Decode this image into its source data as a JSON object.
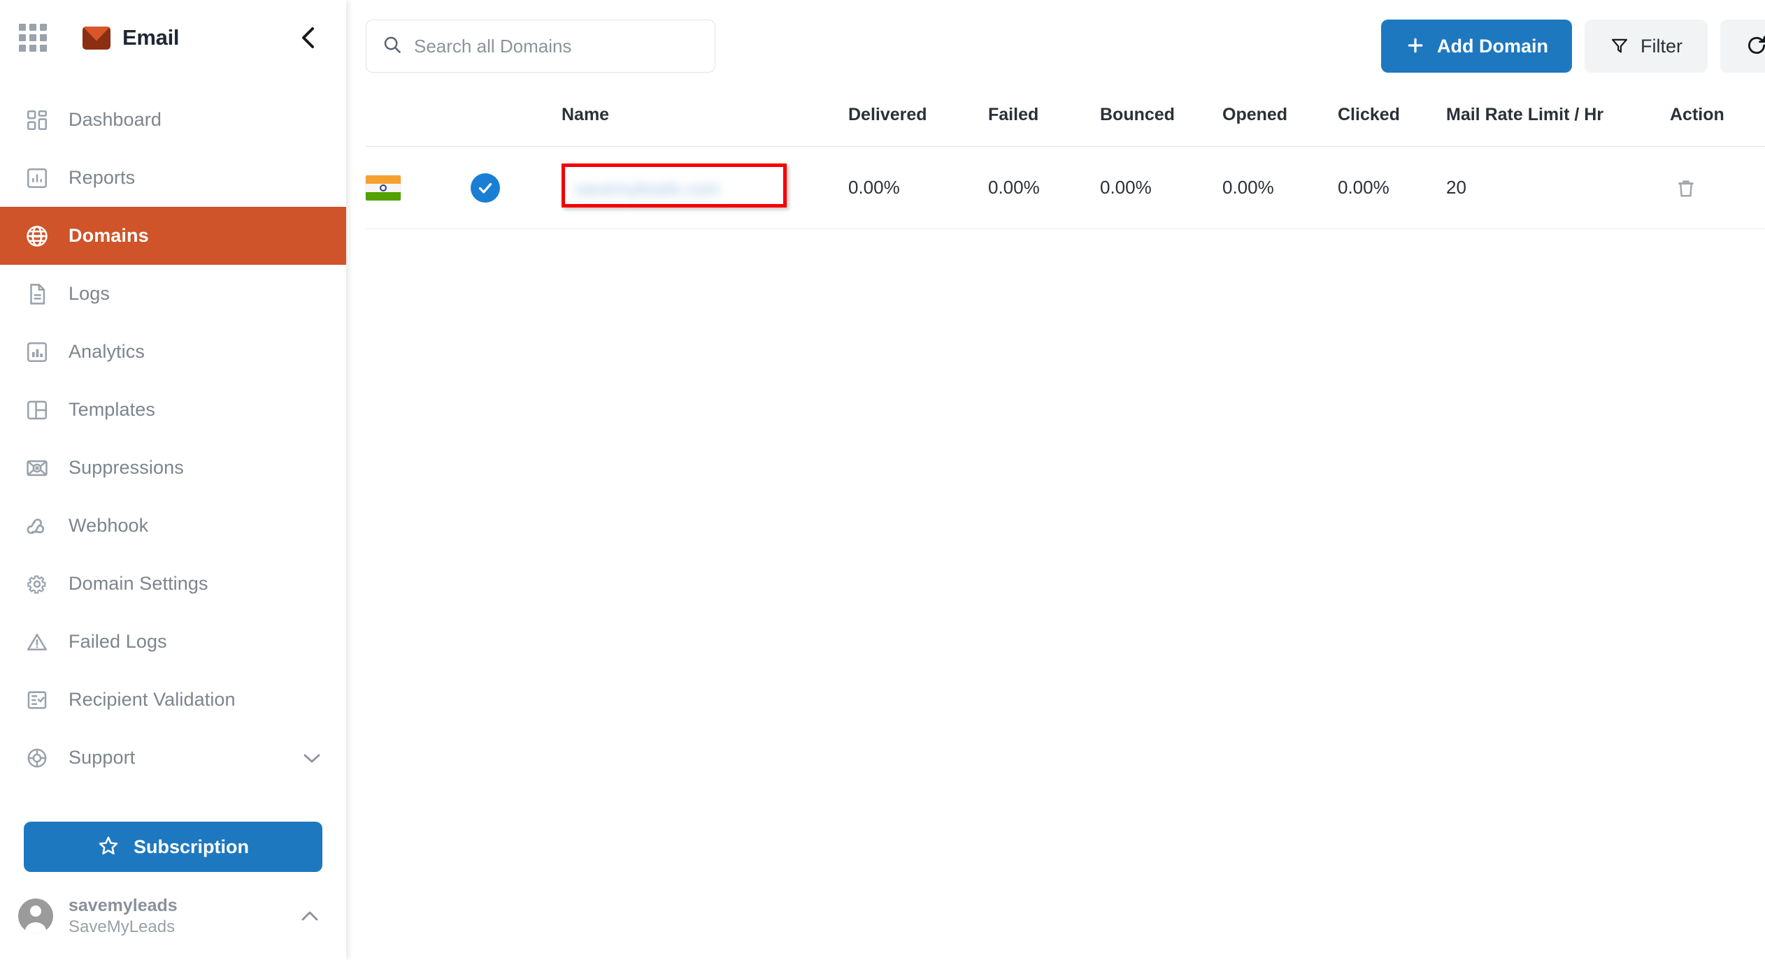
{
  "app": {
    "brand_name": "Email",
    "accent_orange": "#d05429",
    "accent_blue": "#1e78bf",
    "highlight_red": "#f40000"
  },
  "sidebar": {
    "apps_icon": "apps-grid-icon",
    "logo_icon": "email-envelope-logo",
    "collapse_icon": "chevron-left-icon",
    "items": [
      {
        "label": "Dashboard",
        "icon": "dashboard-icon",
        "active": false
      },
      {
        "label": "Reports",
        "icon": "bar-chart-icon",
        "active": false
      },
      {
        "label": "Domains",
        "icon": "globe-www-icon",
        "active": true
      },
      {
        "label": "Logs",
        "icon": "document-lines-icon",
        "active": false
      },
      {
        "label": "Analytics",
        "icon": "analytics-chart-icon",
        "active": false
      },
      {
        "label": "Templates",
        "icon": "layout-panels-icon",
        "active": false
      },
      {
        "label": "Suppressions",
        "icon": "envelope-blocked-icon",
        "active": false
      },
      {
        "label": "Webhook",
        "icon": "webhook-icon",
        "active": false
      },
      {
        "label": "Domain Settings",
        "icon": "gear-icon",
        "active": false
      },
      {
        "label": "Failed Logs",
        "icon": "warning-triangle-icon",
        "active": false
      },
      {
        "label": "Recipient Validation",
        "icon": "checklist-icon",
        "active": false
      },
      {
        "label": "Support",
        "icon": "lifebuoy-icon",
        "active": false,
        "chevron": "chevron-down-icon"
      }
    ],
    "subscription": {
      "label": "Subscription",
      "icon": "star-icon"
    },
    "user": {
      "name": "savemyleads",
      "org": "SaveMyLeads",
      "avatar_icon": "user-avatar-icon",
      "chevron": "chevron-up-icon"
    }
  },
  "toolbar": {
    "search": {
      "placeholder": "Search all Domains",
      "value": "",
      "icon": "search-icon"
    },
    "add_domain": {
      "label": "Add Domain",
      "icon": "plus-icon"
    },
    "filter": {
      "label": "Filter",
      "icon": "funnel-icon"
    },
    "refresh": {
      "label": "",
      "icon": "refresh-icon"
    }
  },
  "table": {
    "columns": [
      {
        "key": "flag",
        "label": ""
      },
      {
        "key": "verified",
        "label": ""
      },
      {
        "key": "name",
        "label": "Name"
      },
      {
        "key": "delivered",
        "label": "Delivered"
      },
      {
        "key": "failed",
        "label": "Failed"
      },
      {
        "key": "bounced",
        "label": "Bounced"
      },
      {
        "key": "opened",
        "label": "Opened"
      },
      {
        "key": "clicked",
        "label": "Clicked"
      },
      {
        "key": "rate",
        "label": "Mail Rate Limit / Hr"
      },
      {
        "key": "action",
        "label": "Action"
      }
    ],
    "rows": [
      {
        "flag_icon": "india-flag-icon",
        "verified_icon": "verified-check-icon",
        "name": "savemyleads.com",
        "name_obscured": true,
        "name_highlighted": true,
        "delivered": "0.00%",
        "failed": "0.00%",
        "bounced": "0.00%",
        "opened": "0.00%",
        "clicked": "0.00%",
        "rate": "20",
        "action_icon": "trash-icon"
      }
    ]
  }
}
